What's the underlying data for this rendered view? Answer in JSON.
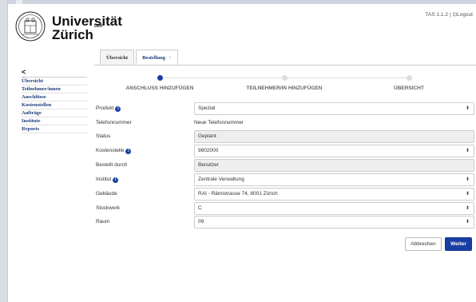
{
  "brand": {
    "name_line1": "Universität",
    "name_line2": "Zürich",
    "superscript": "UZH"
  },
  "topbar": {
    "version": "TAS 1.1.2",
    "separator": "|",
    "logout_label": "Logout"
  },
  "sidebar": {
    "back_label": "<",
    "items": [
      {
        "label": "Übersicht"
      },
      {
        "label": "Teilnehmer/innen"
      },
      {
        "label": "Anschlüsse"
      },
      {
        "label": "Kostenstellen"
      },
      {
        "label": "Aufträge"
      },
      {
        "label": "Institute"
      },
      {
        "label": "Reports"
      }
    ]
  },
  "tabs": [
    {
      "label": "Übersicht",
      "active": false
    },
    {
      "label": "Bestellung",
      "active": true,
      "close": "×"
    }
  ],
  "stepper": {
    "steps": [
      {
        "label": "ANSCHLUSS HINZUFÜGEN",
        "active": true
      },
      {
        "label": "TEILNEHMER/IN HINZUFÜGEN",
        "active": false
      },
      {
        "label": "ÜBERSICHT",
        "active": false
      }
    ]
  },
  "form": {
    "produkt": {
      "label": "Produkt",
      "value": "Spezial"
    },
    "telefonnummer": {
      "label": "Telefonnummer",
      "value": "Neue Telefonnummer"
    },
    "status": {
      "label": "Status",
      "value": "Geplant"
    },
    "kostenstelle": {
      "label": "Kostenstelle",
      "value": "9802000"
    },
    "bestellt_durch": {
      "label": "Bestellt durch",
      "value": "Benutzer"
    },
    "institut": {
      "label": "Institut",
      "value": "Zentrale Verwaltung"
    },
    "gebaeude": {
      "label": "Gebäude",
      "value": "RAI - Rämistrasse 74, 8001 Zürich"
    },
    "stockwerk": {
      "label": "Stockwerk",
      "value": "C"
    },
    "raum": {
      "label": "Raum",
      "value": "09"
    }
  },
  "buttons": {
    "cancel": "Abbrechen",
    "next": "Weiter"
  },
  "colors": {
    "accent": "#1a3fa3",
    "nav_link": "#1d3b7a"
  },
  "icons": {
    "info": "info-circle-icon",
    "select_arrow": "select-arrow-icon",
    "logout": "logout-icon",
    "seal": "university-seal-icon"
  }
}
